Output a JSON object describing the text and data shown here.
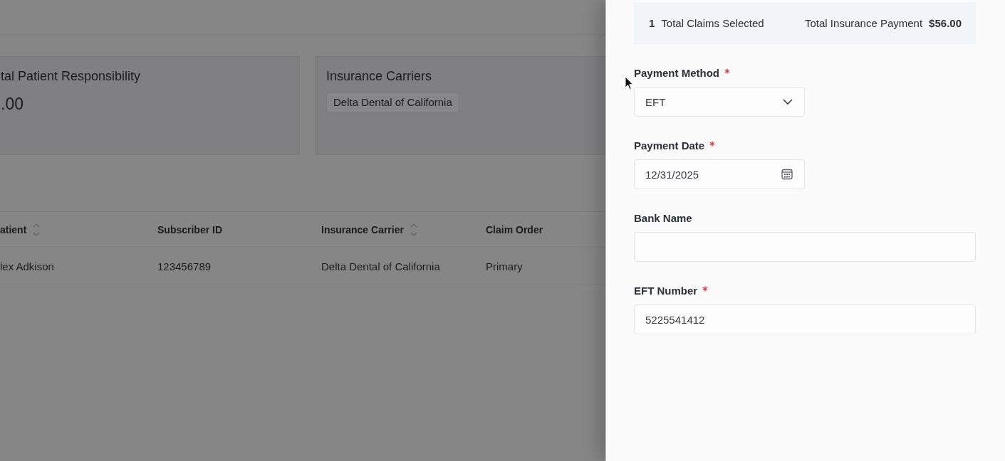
{
  "background_page": {
    "summary_cards": [
      {
        "kind": "amount",
        "title": "tal Patient Responsibility",
        "value": ".00"
      },
      {
        "kind": "tags",
        "title": "Insurance Carriers",
        "tags": [
          "Delta Dental of California"
        ]
      }
    ],
    "table": {
      "columns": [
        {
          "label": "atient",
          "sortable": true
        },
        {
          "label": "Subscriber ID",
          "sortable": false
        },
        {
          "label": "Insurance Carrier",
          "sortable": true
        },
        {
          "label": "Claim Order",
          "sortable": false
        }
      ],
      "rows": [
        [
          "lex Adkison",
          "123456789",
          "Delta Dental of California",
          "Primary"
        ]
      ]
    }
  },
  "drawer": {
    "summary": {
      "claims_count": "1",
      "claims_label": "Total Claims Selected",
      "payment_label": "Total Insurance Payment",
      "payment_amount": "$56.00"
    },
    "fields": [
      {
        "kind": "select",
        "label": "Payment Method",
        "required": true,
        "value": "EFT"
      },
      {
        "kind": "date",
        "label": "Payment Date",
        "required": true,
        "value": "12/31/2025"
      },
      {
        "kind": "text",
        "label": "Bank Name",
        "required": false
      },
      {
        "kind": "text",
        "label": "EFT Number",
        "required": true,
        "value": "5225541412"
      }
    ]
  }
}
